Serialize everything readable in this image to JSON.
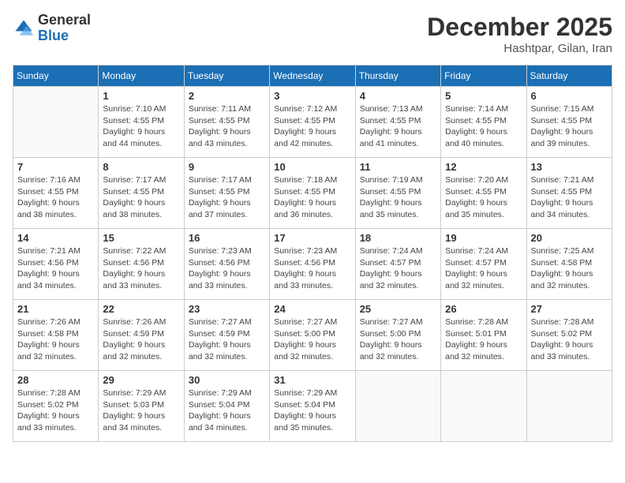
{
  "header": {
    "logo_general": "General",
    "logo_blue": "Blue",
    "month_title": "December 2025",
    "subtitle": "Hashtpar, Gilan, Iran"
  },
  "days_of_week": [
    "Sunday",
    "Monday",
    "Tuesday",
    "Wednesday",
    "Thursday",
    "Friday",
    "Saturday"
  ],
  "weeks": [
    [
      {
        "day": "",
        "info": ""
      },
      {
        "day": "1",
        "info": "Sunrise: 7:10 AM\nSunset: 4:55 PM\nDaylight: 9 hours\nand 44 minutes."
      },
      {
        "day": "2",
        "info": "Sunrise: 7:11 AM\nSunset: 4:55 PM\nDaylight: 9 hours\nand 43 minutes."
      },
      {
        "day": "3",
        "info": "Sunrise: 7:12 AM\nSunset: 4:55 PM\nDaylight: 9 hours\nand 42 minutes."
      },
      {
        "day": "4",
        "info": "Sunrise: 7:13 AM\nSunset: 4:55 PM\nDaylight: 9 hours\nand 41 minutes."
      },
      {
        "day": "5",
        "info": "Sunrise: 7:14 AM\nSunset: 4:55 PM\nDaylight: 9 hours\nand 40 minutes."
      },
      {
        "day": "6",
        "info": "Sunrise: 7:15 AM\nSunset: 4:55 PM\nDaylight: 9 hours\nand 39 minutes."
      }
    ],
    [
      {
        "day": "7",
        "info": "Sunrise: 7:16 AM\nSunset: 4:55 PM\nDaylight: 9 hours\nand 38 minutes."
      },
      {
        "day": "8",
        "info": "Sunrise: 7:17 AM\nSunset: 4:55 PM\nDaylight: 9 hours\nand 38 minutes."
      },
      {
        "day": "9",
        "info": "Sunrise: 7:17 AM\nSunset: 4:55 PM\nDaylight: 9 hours\nand 37 minutes."
      },
      {
        "day": "10",
        "info": "Sunrise: 7:18 AM\nSunset: 4:55 PM\nDaylight: 9 hours\nand 36 minutes."
      },
      {
        "day": "11",
        "info": "Sunrise: 7:19 AM\nSunset: 4:55 PM\nDaylight: 9 hours\nand 35 minutes."
      },
      {
        "day": "12",
        "info": "Sunrise: 7:20 AM\nSunset: 4:55 PM\nDaylight: 9 hours\nand 35 minutes."
      },
      {
        "day": "13",
        "info": "Sunrise: 7:21 AM\nSunset: 4:55 PM\nDaylight: 9 hours\nand 34 minutes."
      }
    ],
    [
      {
        "day": "14",
        "info": "Sunrise: 7:21 AM\nSunset: 4:56 PM\nDaylight: 9 hours\nand 34 minutes."
      },
      {
        "day": "15",
        "info": "Sunrise: 7:22 AM\nSunset: 4:56 PM\nDaylight: 9 hours\nand 33 minutes."
      },
      {
        "day": "16",
        "info": "Sunrise: 7:23 AM\nSunset: 4:56 PM\nDaylight: 9 hours\nand 33 minutes."
      },
      {
        "day": "17",
        "info": "Sunrise: 7:23 AM\nSunset: 4:56 PM\nDaylight: 9 hours\nand 33 minutes."
      },
      {
        "day": "18",
        "info": "Sunrise: 7:24 AM\nSunset: 4:57 PM\nDaylight: 9 hours\nand 32 minutes."
      },
      {
        "day": "19",
        "info": "Sunrise: 7:24 AM\nSunset: 4:57 PM\nDaylight: 9 hours\nand 32 minutes."
      },
      {
        "day": "20",
        "info": "Sunrise: 7:25 AM\nSunset: 4:58 PM\nDaylight: 9 hours\nand 32 minutes."
      }
    ],
    [
      {
        "day": "21",
        "info": "Sunrise: 7:26 AM\nSunset: 4:58 PM\nDaylight: 9 hours\nand 32 minutes."
      },
      {
        "day": "22",
        "info": "Sunrise: 7:26 AM\nSunset: 4:59 PM\nDaylight: 9 hours\nand 32 minutes."
      },
      {
        "day": "23",
        "info": "Sunrise: 7:27 AM\nSunset: 4:59 PM\nDaylight: 9 hours\nand 32 minutes."
      },
      {
        "day": "24",
        "info": "Sunrise: 7:27 AM\nSunset: 5:00 PM\nDaylight: 9 hours\nand 32 minutes."
      },
      {
        "day": "25",
        "info": "Sunrise: 7:27 AM\nSunset: 5:00 PM\nDaylight: 9 hours\nand 32 minutes."
      },
      {
        "day": "26",
        "info": "Sunrise: 7:28 AM\nSunset: 5:01 PM\nDaylight: 9 hours\nand 32 minutes."
      },
      {
        "day": "27",
        "info": "Sunrise: 7:28 AM\nSunset: 5:02 PM\nDaylight: 9 hours\nand 33 minutes."
      }
    ],
    [
      {
        "day": "28",
        "info": "Sunrise: 7:28 AM\nSunset: 5:02 PM\nDaylight: 9 hours\nand 33 minutes."
      },
      {
        "day": "29",
        "info": "Sunrise: 7:29 AM\nSunset: 5:03 PM\nDaylight: 9 hours\nand 34 minutes."
      },
      {
        "day": "30",
        "info": "Sunrise: 7:29 AM\nSunset: 5:04 PM\nDaylight: 9 hours\nand 34 minutes."
      },
      {
        "day": "31",
        "info": "Sunrise: 7:29 AM\nSunset: 5:04 PM\nDaylight: 9 hours\nand 35 minutes."
      },
      {
        "day": "",
        "info": ""
      },
      {
        "day": "",
        "info": ""
      },
      {
        "day": "",
        "info": ""
      }
    ]
  ]
}
